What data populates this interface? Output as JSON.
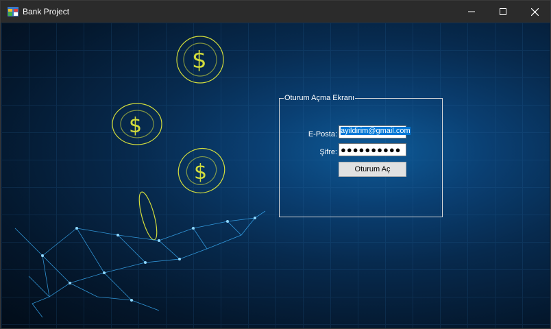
{
  "window": {
    "title": "Bank Project",
    "icons": {
      "app": "app-icon",
      "minimize": "minimize-icon",
      "maximize": "maximize-icon",
      "close": "close-icon"
    }
  },
  "login": {
    "group_title": "Oturum Açma Ekranı",
    "email_label": "E-Posta:",
    "email_value": "ayildirim@gmail.com",
    "password_label": "Şifre:",
    "password_value": "●●●●●●●●●●",
    "submit_label": "Oturum Aç"
  },
  "colors": {
    "title_bar": "#2b2b2b",
    "background": "#072a4e",
    "selection": "#0078d7",
    "coin": "#e8f03a",
    "hand": "#3cb4ff"
  }
}
